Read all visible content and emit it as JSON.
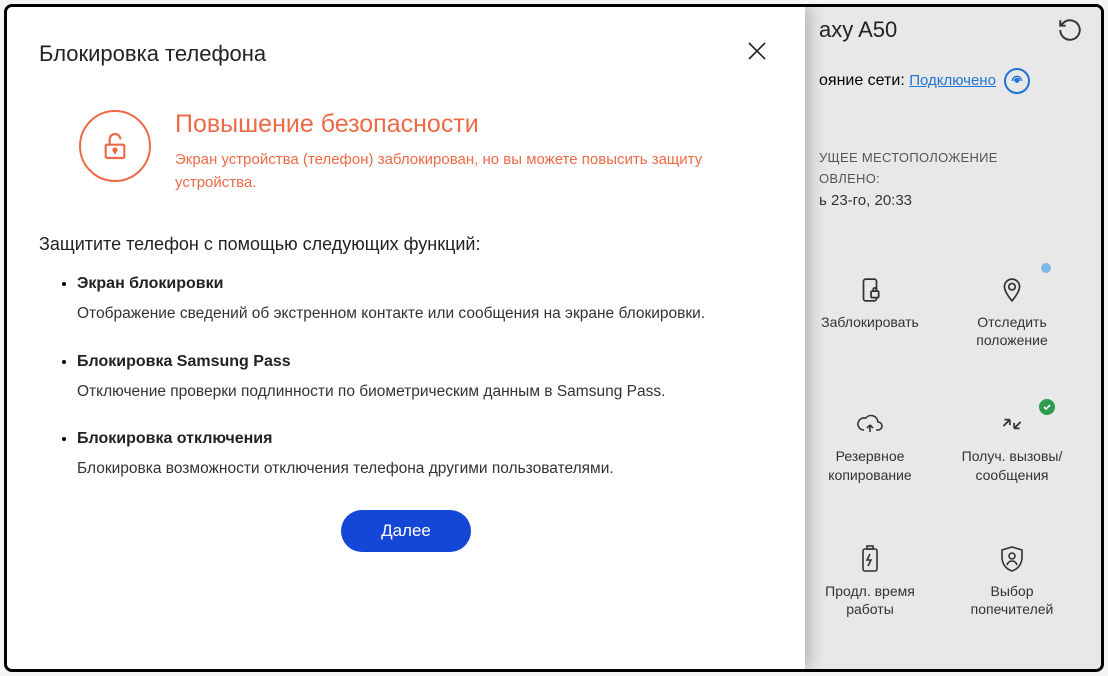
{
  "modal": {
    "title": "Блокировка телефона",
    "security": {
      "heading": "Повышение безопасности",
      "text": "Экран устройства (телефон) заблокирован, но вы можете повысить защиту устройства."
    },
    "protect_heading": "Защитите телефон с помощью следующих функций:",
    "features": [
      {
        "title": "Экран блокировки",
        "desc": "Отображение сведений об экстренном контакте или сообщения на экране блокировки."
      },
      {
        "title": "Блокировка Samsung Pass",
        "desc": "Отключение проверки подлинности по биометрическим данным в Samsung Pass."
      },
      {
        "title": "Блокировка отключения",
        "desc": "Блокировка возможности отключения телефона другими пользователями."
      }
    ],
    "next_label": "Далее"
  },
  "bg": {
    "device_title_fragment": "axy A50",
    "network_prefix": "ояние сети: ",
    "network_status": "Подключено",
    "location": {
      "label_fragment": "УЩЕЕ МЕСТОПОЛОЖЕНИЕ",
      "updated_fragment": "ОВЛЕНО:",
      "time_fragment": "ь 23-го, 20:33"
    },
    "actions": {
      "lock": "Заблокировать",
      "track": "Отследить положение",
      "backup": "Резервное копирование",
      "calls": "Получ. вызовы/сообщения",
      "extend": "Продл. время работы",
      "guardians": "Выбор попечителей"
    }
  }
}
